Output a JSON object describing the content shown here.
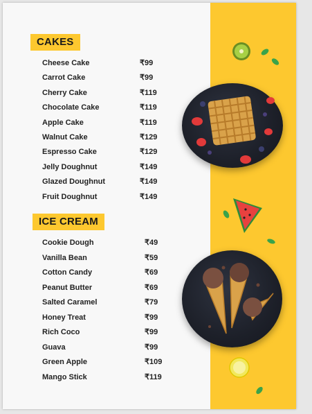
{
  "cakes": {
    "title": "CAKES",
    "items": [
      {
        "name": "Cheese Cake",
        "price": "₹99"
      },
      {
        "name": "Carrot Cake",
        "price": "₹99"
      },
      {
        "name": "Cherry Cake",
        "price": "₹119"
      },
      {
        "name": "Chocolate Cake",
        "price": "₹119"
      },
      {
        "name": "Apple Cake",
        "price": "₹119"
      },
      {
        "name": "Walnut Cake",
        "price": "₹129"
      },
      {
        "name": "Espresso Cake",
        "price": "₹129"
      },
      {
        "name": "Jelly Doughnut",
        "price": "₹149"
      },
      {
        "name": "Glazed Doughnut",
        "price": "₹149"
      },
      {
        "name": "Fruit Doughnut",
        "price": "₹149"
      }
    ]
  },
  "ice_cream": {
    "title": "ICE CREAM",
    "items": [
      {
        "name": "Cookie Dough",
        "price": "₹49"
      },
      {
        "name": "Vanilla Bean",
        "price": "₹59"
      },
      {
        "name": "Cotton Candy",
        "price": "₹69"
      },
      {
        "name": "Peanut Butter",
        "price": "₹69"
      },
      {
        "name": "Salted Caramel",
        "price": "₹79"
      },
      {
        "name": "Honey Treat",
        "price": "₹99"
      },
      {
        "name": "Rich Coco",
        "price": "₹99"
      },
      {
        "name": "Guava",
        "price": "₹99"
      },
      {
        "name": "Green Apple",
        "price": "₹109"
      },
      {
        "name": "Mango Stick",
        "price": "₹119"
      }
    ]
  },
  "colors": {
    "accent": "#fdc82f",
    "text": "#222222",
    "page": "#f8f8f8",
    "plate": "#1d2029"
  },
  "images": {
    "top_plate": "waffle-with-berries-image",
    "bottom_plate": "ice-cream-cones-image",
    "decor": [
      "kiwi-slice-icon",
      "watermelon-slice-icon",
      "lemon-slice-icon",
      "mint-leaf-icon"
    ]
  }
}
